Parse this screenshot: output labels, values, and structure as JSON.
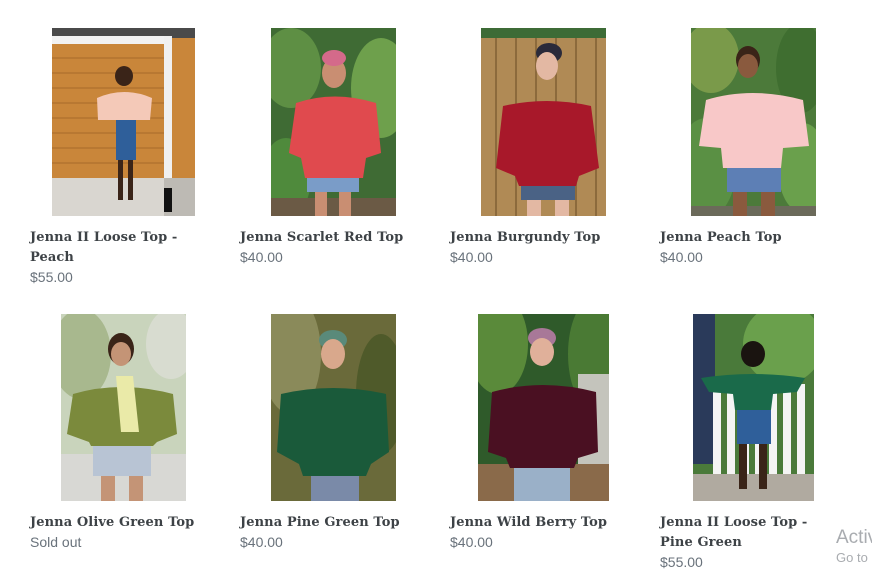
{
  "products": [
    {
      "title": "Jenna II Loose Top - Peach",
      "price": "$55.00",
      "image": "peach-loose-top-photo"
    },
    {
      "title": "Jenna Scarlet Red Top",
      "price": "$40.00",
      "image": "scarlet-red-top-photo"
    },
    {
      "title": "Jenna Burgundy Top",
      "price": "$40.00",
      "image": "burgundy-top-photo"
    },
    {
      "title": "Jenna Peach Top",
      "price": "$40.00",
      "image": "peach-top-photo"
    },
    {
      "title": "Jenna Olive Green Top",
      "price": "Sold out",
      "image": "olive-green-top-photo"
    },
    {
      "title": "Jenna Pine Green Top",
      "price": "$40.00",
      "image": "pine-green-top-photo"
    },
    {
      "title": "Jenna Wild Berry Top",
      "price": "$40.00",
      "image": "wild-berry-top-photo"
    },
    {
      "title": "Jenna II Loose Top - Pine Green",
      "price": "$55.00",
      "image": "pine-green-loose-top-photo"
    }
  ],
  "watermark": {
    "line1": "Activ",
    "line2": "Go to"
  }
}
